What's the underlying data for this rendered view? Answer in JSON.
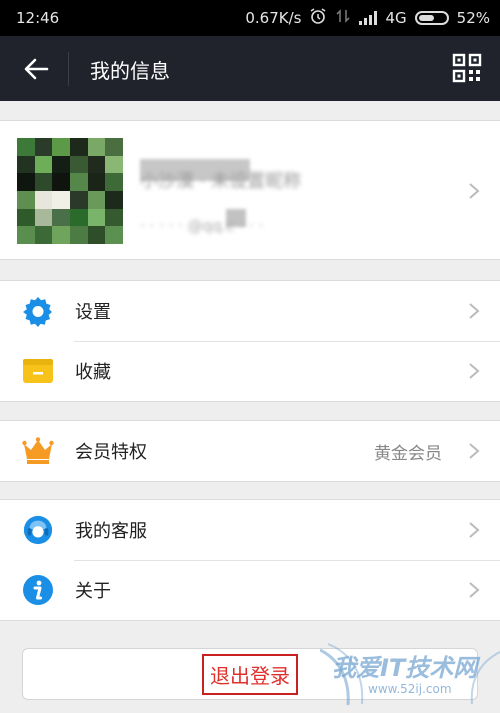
{
  "status_bar": {
    "time": "12:46",
    "speed": "0.67K/s",
    "network": "4G",
    "battery": "52%"
  },
  "header": {
    "title": "我的信息",
    "back_icon": "back-arrow-icon",
    "qr_icon": "qr-code-icon"
  },
  "profile": {
    "nickname": "小沙漠 · 未设置昵称",
    "account": "· · · · · @qq.c · · ·"
  },
  "menu": {
    "settings": "设置",
    "favorites": "收藏",
    "membership": "会员特权",
    "membership_level": "黄金会员",
    "customer_service": "我的客服",
    "about": "关于"
  },
  "logout": {
    "label": "退出登录"
  },
  "watermark": {
    "text": "我爱IT技术网",
    "url": "www.52ij.com"
  },
  "colors": {
    "header_bg": "#20232c",
    "accent_blue": "#1b8ee6",
    "favorites_yellow": "#f7c21a",
    "crown_orange": "#f59a23",
    "logout_red": "#e0302b"
  }
}
